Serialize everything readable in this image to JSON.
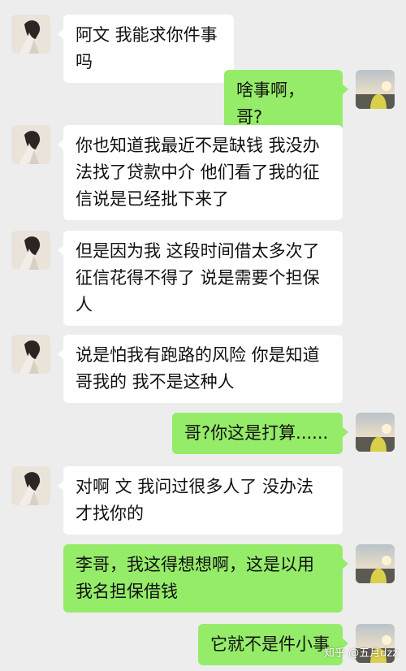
{
  "messages": [
    {
      "side": "in",
      "text": "阿文 我能求你件事吗"
    },
    {
      "side": "out",
      "text": "啥事啊，哥?"
    },
    {
      "side": "in",
      "text": "你也知道我最近不是缺钱 我没办法找了贷款中介 他们看了我的征信说是已经批下来了"
    },
    {
      "side": "in",
      "text": "但是因为我 这段时间借太多次了 征信花得不得了 说是需要个担保人"
    },
    {
      "side": "in",
      "text": "说是怕我有跑路的风险 你是知道哥我的 我不是这种人"
    },
    {
      "side": "out",
      "text": "哥?你这是打算......"
    },
    {
      "side": "in",
      "text": "对啊 文 我问过很多人了 没办法才找你的"
    },
    {
      "side": "out",
      "text": "李哥，我这得想想啊，这是以用我名担保借钱"
    },
    {
      "side": "out",
      "text": "它就不是件小事"
    }
  ],
  "watermark": "知乎 @五月dzz",
  "colors": {
    "background": "#ededed",
    "incoming_bubble": "#ffffff",
    "outgoing_bubble": "#95ec69"
  },
  "avatars": {
    "incoming": "friend-avatar-photo",
    "outgoing": "user-avatar-sunset-photo"
  }
}
